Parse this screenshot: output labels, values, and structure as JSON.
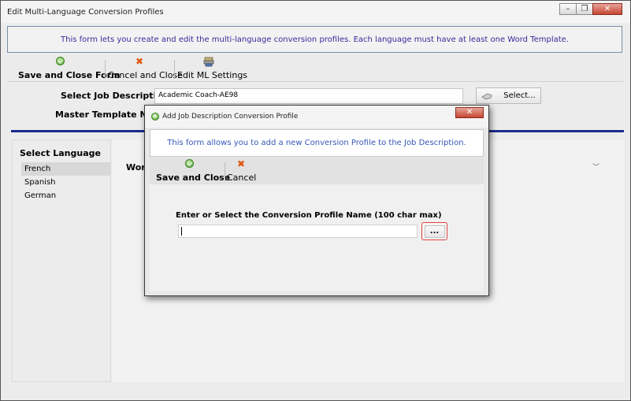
{
  "window": {
    "title": "Edit Multi-Language Conversion Profiles",
    "minimize_icon": "minimize-icon",
    "restore_icon": "restore-icon",
    "close_icon": "close-icon"
  },
  "info": "This form lets you create and edit the multi-language conversion profiles. Each language must have at least one Word Template.",
  "toolbar": {
    "save_close": "Save and Close Form",
    "cancel_close": "Cancel and Close",
    "edit_ml": "Edit ML Settings"
  },
  "form": {
    "job_description_label": "Select Job Description",
    "job_description_value": "Academic Coach-AE98",
    "select_button": "Select...",
    "master_template_label": "Master Template Name"
  },
  "languages": {
    "title": "Select Language",
    "items": [
      "French",
      "Spanish",
      "German"
    ],
    "selected": "French"
  },
  "right_panel": {
    "word_label": "Word"
  },
  "dialog": {
    "title": "Add Job Description Conversion Profile",
    "info": "This form allows you to add a new Conversion Profile to the Job Description.",
    "save_close": "Save and Close",
    "cancel": "Cancel",
    "field_label": "Enter or Select the Conversion Profile Name (100 char max)",
    "field_value": "",
    "browse_button": "..."
  },
  "colors": {
    "accent_bar": "#1c2a8c",
    "info_text": "#3a2a9a",
    "dialog_info_text": "#3557b8",
    "highlight_border": "#e04040"
  }
}
